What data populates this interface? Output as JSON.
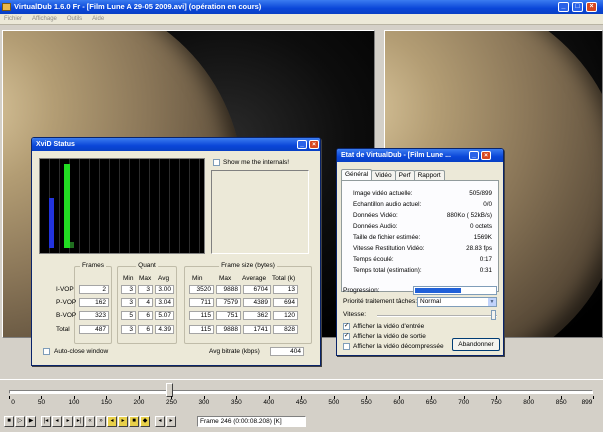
{
  "window": {
    "title": "VirtualDub 1.6.0 Fr - [Film Lune A 29-05 2009.avi] (opération en cours)",
    "min": "_",
    "max": "□",
    "close": "×"
  },
  "menu": [
    "Fichier",
    "Affichage",
    "Outils",
    "Aide"
  ],
  "xvid": {
    "title": "XviD Status",
    "show_internals": "Show me the internals!",
    "headers": {
      "frames": "Frames",
      "quant": "Quant",
      "framesize": "Frame size (bytes)"
    },
    "subheaders": {
      "min": "Min",
      "max": "Max",
      "avg": "Avg",
      "fmin": "Min",
      "fmax": "Max",
      "faverage": "Average",
      "ftotal": "Total (k)"
    },
    "rows": [
      {
        "label": "I-VOP",
        "frames": "2",
        "qmin": "3",
        "qmax": "3",
        "qavg": "3.00",
        "fmin": "3520",
        "fmax": "9888",
        "favg": "6704",
        "ftot": "13"
      },
      {
        "label": "P-VOP",
        "frames": "162",
        "qmin": "3",
        "qmax": "4",
        "qavg": "3.04",
        "fmin": "711",
        "fmax": "7579",
        "favg": "4389",
        "ftot": "694"
      },
      {
        "label": "B-VOP",
        "frames": "323",
        "qmin": "5",
        "qmax": "6",
        "qavg": "5.07",
        "fmin": "115",
        "fmax": "751",
        "favg": "362",
        "ftot": "120"
      },
      {
        "label": "Total",
        "frames": "487",
        "qmin": "3",
        "qmax": "6",
        "qavg": "4.39",
        "fmin": "115",
        "fmax": "9888",
        "favg": "1741",
        "ftot": "828"
      }
    ],
    "auto_close": "Auto-close window",
    "avg_bitrate_label": "Avg bitrate (kbps)",
    "avg_bitrate": "404",
    "bar_colors": [
      "#2233dd",
      "#22dd22"
    ]
  },
  "vdstate": {
    "title": "Etat de VirtualDub - [Film Lune ...",
    "tabs": [
      "Général",
      "Vidéo",
      "Perf",
      "Rapport"
    ],
    "stats": [
      {
        "label": "Image vidéo actuelle:",
        "value": "505/899"
      },
      {
        "label": "Echantillon audio actuel:",
        "value": "0/0"
      },
      {
        "label": "Données Vidéo:",
        "value": "880Ko ( 52kB/s)"
      },
      {
        "label": "Données Audio:",
        "value": "0 octets"
      },
      {
        "label": "Taille de fichier estimée:",
        "value": "1569K"
      },
      {
        "label": "Vitesse Restitution Vidéo:",
        "value": "28.83 fps"
      },
      {
        "label": "Temps écoulé:",
        "value": "0:17"
      },
      {
        "label": "Temps total (estimation):",
        "value": "0:31"
      }
    ],
    "progress_label": "Progression:",
    "progress": 0.56,
    "priority_label": "Priorité traitement tâches:",
    "priority_value": "Normal",
    "speed_label": "Vitesse:",
    "checks": [
      {
        "label": "Afficher la vidéo d'entrée",
        "checked": true
      },
      {
        "label": "Afficher la vidéo de sortie",
        "checked": true
      },
      {
        "label": "Afficher la vidéo décompressée",
        "checked": false
      }
    ],
    "abort": "Abandonner"
  },
  "timeline": {
    "ticks": [
      "0",
      "50",
      "100",
      "150",
      "200",
      "250",
      "300",
      "350",
      "400",
      "450",
      "500",
      "550",
      "600",
      "650",
      "700",
      "750",
      "800",
      "850",
      "899"
    ],
    "max": 899,
    "position": 246,
    "frame_text": "Frame 246 (0:00:08.208) [K]"
  }
}
